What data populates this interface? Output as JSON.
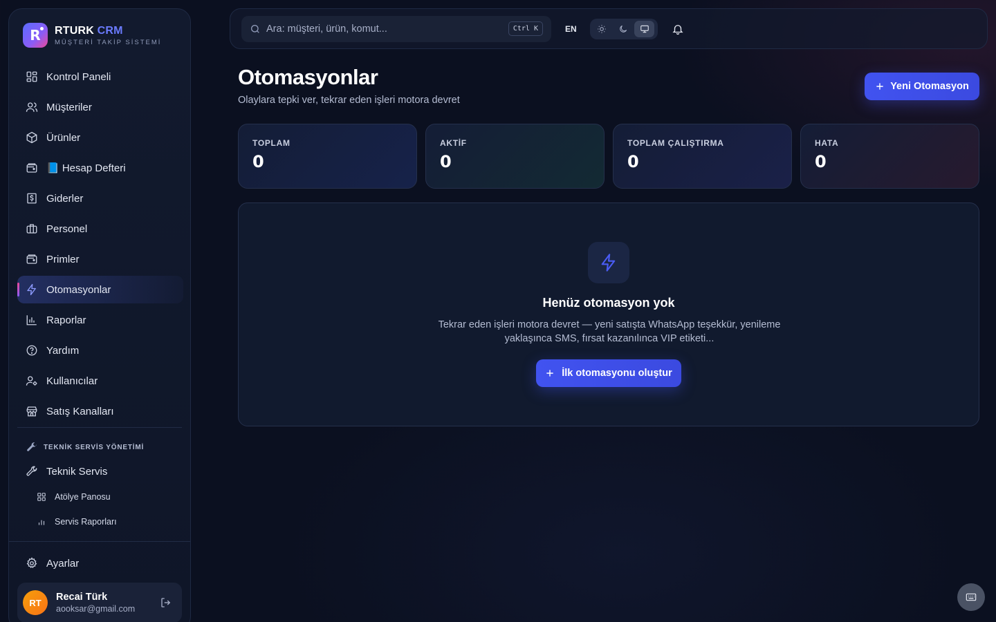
{
  "app": {
    "name_part1": "RTURK",
    "name_part2": "CRM",
    "subtitle": "MÜŞTERİ TAKİP SİSTEMİ",
    "logo_letter": "R"
  },
  "sidebar": {
    "items": [
      {
        "label": "Kontrol Paneli",
        "icon": "dashboard-grid-icon"
      },
      {
        "label": "Müşteriler",
        "icon": "users-icon"
      },
      {
        "label": "Ürünler",
        "icon": "box-icon"
      },
      {
        "label": "📘 Hesap Defteri",
        "icon": "wallet-icon"
      },
      {
        "label": "Giderler",
        "icon": "receipt-dollar-icon"
      },
      {
        "label": "Personel",
        "icon": "briefcase-icon"
      },
      {
        "label": "Primler",
        "icon": "wallet-icon"
      },
      {
        "label": "Otomasyonlar",
        "icon": "lightning-icon",
        "active": true
      },
      {
        "label": "Raporlar",
        "icon": "bar-chart-icon"
      },
      {
        "label": "Yardım",
        "icon": "help-circle-icon"
      },
      {
        "label": "Kullanıcılar",
        "icon": "user-gear-icon"
      },
      {
        "label": "Satış Kanalları",
        "icon": "store-icon"
      }
    ],
    "section_title": "TEKNİK SERVİS YÖNETİMİ",
    "service_item": "Teknik Servis",
    "sub_items": [
      {
        "label": "Atölye Panosu",
        "icon": "grid-icon"
      },
      {
        "label": "Servis Raporları",
        "icon": "bar-chart-icon"
      }
    ],
    "settings": "Ayarlar"
  },
  "user": {
    "initials": "RT",
    "name": "Recai Türk",
    "email": "aooksar@gmail.com"
  },
  "topbar": {
    "search_placeholder": "Ara: müşteri, ürün, komut...",
    "shortcut": "Ctrl K",
    "language": "EN",
    "theme_selected": "system"
  },
  "page": {
    "title": "Otomasyonlar",
    "subtitle": "Olaylara tepki ver, tekrar eden işleri motora devret",
    "new_button": "Yeni Otomasyon"
  },
  "stats": [
    {
      "label": "TOPLAM",
      "value": "0"
    },
    {
      "label": "AKTİF",
      "value": "0"
    },
    {
      "label": "TOPLAM ÇALIŞTIRMA",
      "value": "0"
    },
    {
      "label": "HATA",
      "value": "0"
    }
  ],
  "empty_state": {
    "title": "Henüz otomasyon yok",
    "description": "Tekrar eden işleri motora devret — yeni satışta WhatsApp teşekkür, yenileme yaklaşınca SMS, fırsat kazanılınca VIP etiketi...",
    "button": "İlk otomasyonu oluştur"
  },
  "colors": {
    "accent": "#4153f0",
    "background": "#0b1020",
    "brand_secondary": "#6b7bff"
  }
}
